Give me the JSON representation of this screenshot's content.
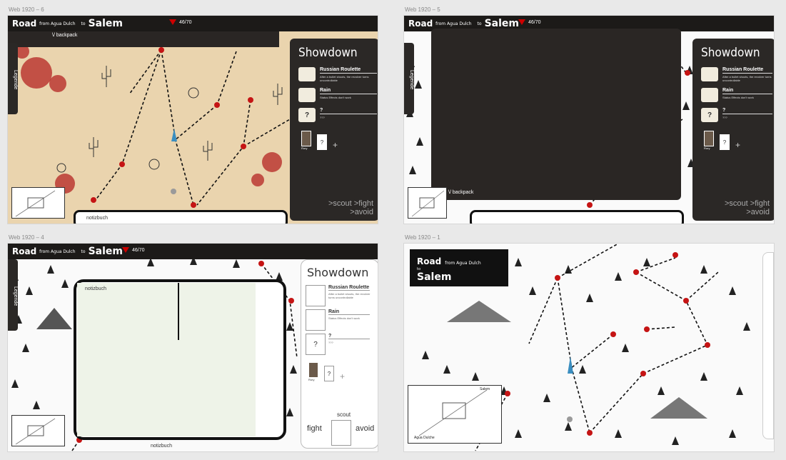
{
  "frames": [
    {
      "label": "Web 1920 – 6"
    },
    {
      "label": "Web 1920 – 5"
    },
    {
      "label": "Web 1920 – 4"
    },
    {
      "label": "Web 1920 – 1"
    }
  ],
  "header": {
    "road": "Road",
    "from": "from Agua Dulch",
    "to": "to",
    "dest": "Salem",
    "hp": "46/70"
  },
  "backpack": "\\/ backpack",
  "legend": "Legende",
  "notiz": "notizbuch",
  "showdown": {
    "title": "Showdown",
    "cards": [
      {
        "icon": "",
        "title": "Russian Roulette",
        "desc": "After a bullet shoots, the revolver turns uncontrollable"
      },
      {
        "icon": "",
        "title": "Rain",
        "desc": "Status Effects don't work"
      },
      {
        "icon": "?",
        "title": "?",
        "desc": "???"
      }
    ],
    "char_name": "Rory",
    "char_q": "?",
    "plus": "+"
  },
  "actions": {
    "scout": ">scout",
    "fight": ">fight",
    "avoid": ">avoid",
    "scout_plain": "scout",
    "fight_plain": "fight",
    "avoid_plain": "avoid"
  },
  "minimap": {
    "start": "Agua Dulche",
    "end": "Salem"
  },
  "titlebox": {
    "road": "Road",
    "from": "from Agua Dulch",
    "to": "to",
    "dest": "Salem"
  }
}
